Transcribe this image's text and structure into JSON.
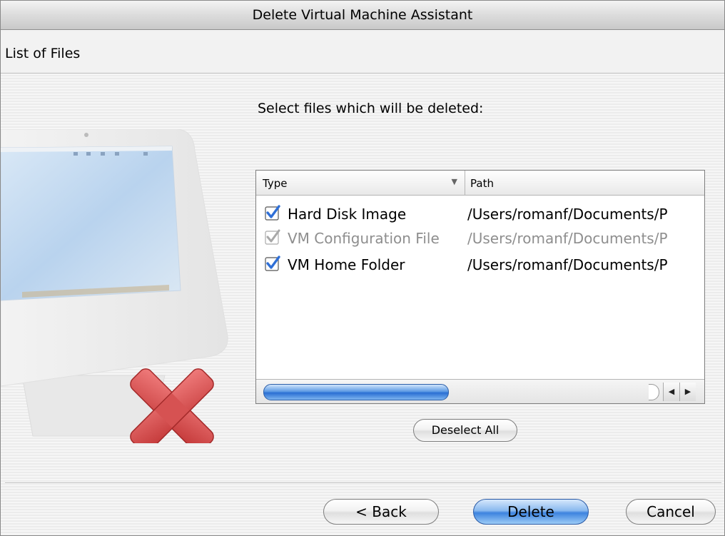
{
  "window": {
    "title": "Delete Virtual Machine Assistant"
  },
  "section": {
    "title": "List of Files"
  },
  "instruction": "Select files which will be deleted:",
  "table": {
    "columns": {
      "type": "Type",
      "path": "Path"
    },
    "sort_indicator": "▼",
    "rows": [
      {
        "type": "Hard Disk Image",
        "path": "/Users/romanf/Documents/P",
        "checked": true,
        "enabled": true
      },
      {
        "type": "VM Configuration File",
        "path": "/Users/romanf/Documents/P",
        "checked": true,
        "enabled": false
      },
      {
        "type": "VM Home Folder",
        "path": "/Users/romanf/Documents/P",
        "checked": true,
        "enabled": true
      }
    ],
    "scroll_position": 0.0
  },
  "buttons": {
    "deselect_all": "Deselect All",
    "back": "< Back",
    "delete": "Delete",
    "cancel": "Cancel"
  },
  "icons": {
    "illustration": "computer-with-delete-x-icon",
    "checkbox": "checkbox-checked-icon",
    "scroll_left": "◀",
    "scroll_right": "▶"
  },
  "colors": {
    "accent": "#3d83df",
    "checkbox": "#2f6fd6",
    "delete_x": "#d64a4a"
  }
}
